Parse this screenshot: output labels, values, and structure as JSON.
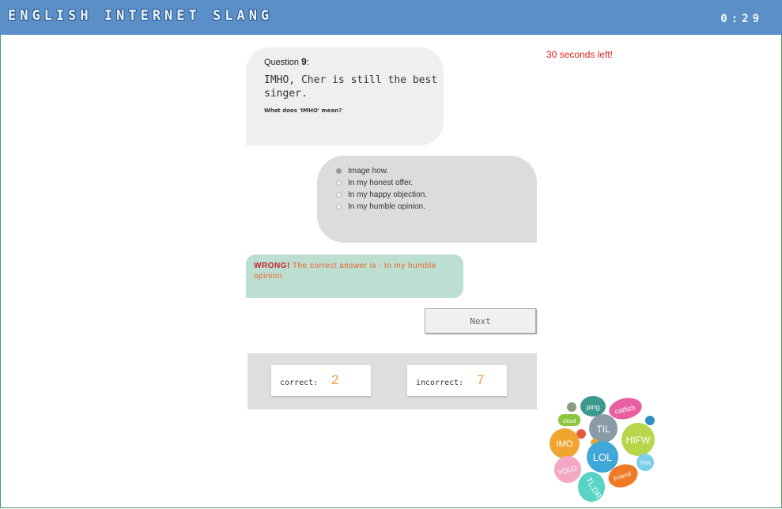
{
  "header": {
    "title": "English Internet Slang",
    "timer": "0:29"
  },
  "time_warning": "30 seconds left!",
  "question": {
    "label": "Question",
    "number": "9",
    "sentence": "IMHO, Cher is still the best singer.",
    "prompt": "What does 'IMHO' mean?"
  },
  "options": [
    {
      "label": "Image how.",
      "selected": true
    },
    {
      "label": "In my honest offer.",
      "selected": false
    },
    {
      "label": "In my happy objection.",
      "selected": false
    },
    {
      "label": "In my humble opinion.",
      "selected": false
    }
  ],
  "result": {
    "verdict": "WRONG!",
    "message": "The correct answer is : In my humble opinion."
  },
  "next_label": "Next",
  "score": {
    "correct_label": "correct:",
    "correct_value": "2",
    "incorrect_label": "incorrect:",
    "incorrect_value": "7"
  },
  "slang_cloud": {
    "words": [
      "ping",
      "catfish",
      "cloud",
      "TIL",
      "HIFW",
      "IMO",
      "LOL",
      "THX",
      "YOLO",
      "Friend",
      "TL;DR"
    ],
    "colors": {
      "ping": "#3a9a8e",
      "catfish": "#e95ea0",
      "cloud": "#8dc63f",
      "TIL": "#8a9aa6",
      "HIFW": "#b8d64a",
      "IMO": "#f0a531",
      "LOL": "#3fa8d8",
      "THX": "#7ccfe8",
      "YOLO": "#f4a8c4",
      "Friend": "#f07a24",
      "TL;DR": "#57d4c4"
    }
  }
}
